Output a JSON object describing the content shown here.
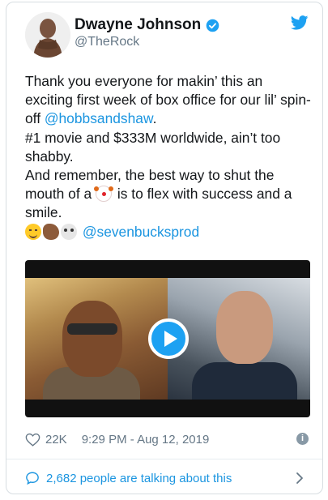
{
  "author": {
    "name": "Dwayne Johnson",
    "handle": "@TheRock"
  },
  "tweet": {
    "line1": "Thank you everyone for makin’ this an exciting first week of box office for our lil’ spin-off ",
    "link_hobbs": "@hobbsandshaw",
    "line1_end": ".",
    "line2": "#1 movie and $333M worldwide, ain’t too shabby.",
    "line3_a": "And remember, the best way to shut the mouth of a ",
    "line3_b": " is to flex with success and a smile.",
    "mention": "@sevenbucksprod"
  },
  "meta": {
    "likes": "22K",
    "timestamp": "9:29 PM - Aug 12, 2019"
  },
  "footer": {
    "talking": "2,682 people are talking about this"
  },
  "colors": {
    "link": "#1b95e0",
    "verified": "#1da1f2",
    "twitter": "#1da1f2"
  },
  "icons": [
    "verified-badge-icon",
    "twitter-bird-icon",
    "play-icon",
    "heart-icon",
    "info-icon",
    "speech-bubble-icon",
    "chevron-right-icon"
  ]
}
